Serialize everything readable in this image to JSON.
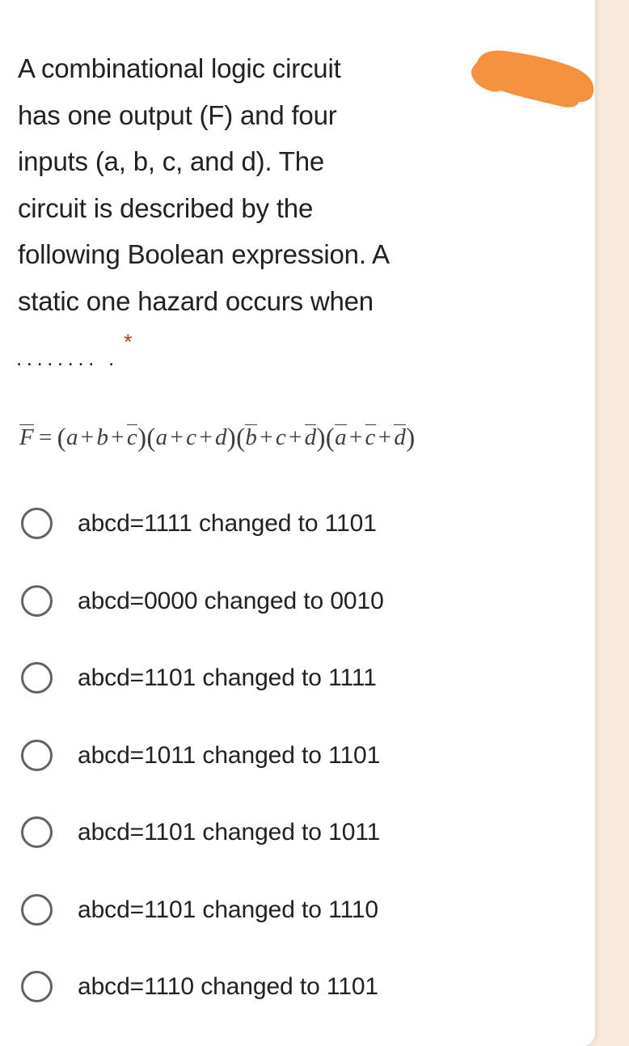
{
  "colors": {
    "page_background": "#faeadb",
    "card_background": "#ffffff",
    "text": "#202124",
    "required_asterisk": "#d93025",
    "highlight_orange": "#f5913e",
    "radio_border": "#5f6368",
    "expression_text": "#3a3f47"
  },
  "question": {
    "lines": [
      "A combinational logic circuit",
      "has one output (F) and four",
      "inputs (a, b, c, and d). The",
      "circuit is described by the",
      "following Boolean expression. A",
      "static one hazard occurs when"
    ],
    "full_text": "A combinational logic circuit has one output (F) and four inputs (a, b, c, and d). The circuit is described by the following Boolean expression. A static one hazard occurs when ......... .",
    "dotted_line": "........",
    "dot_tail": ".",
    "required_marker": "*"
  },
  "expression": {
    "plain": "F̄ = (a + b + c̄)(a + c + d)(b̄ + c + d̄)(ā + c̄ + d̄)",
    "lhs": "F",
    "equals": "=",
    "factors": [
      {
        "terms": [
          {
            "var": "a",
            "bar": false
          },
          {
            "var": "b",
            "bar": false
          },
          {
            "var": "c",
            "bar": true
          }
        ]
      },
      {
        "terms": [
          {
            "var": "a",
            "bar": false
          },
          {
            "var": "c",
            "bar": false
          },
          {
            "var": "d",
            "bar": false
          }
        ]
      },
      {
        "terms": [
          {
            "var": "b",
            "bar": true
          },
          {
            "var": "c",
            "bar": false
          },
          {
            "var": "d",
            "bar": true
          }
        ]
      },
      {
        "terms": [
          {
            "var": "a",
            "bar": true
          },
          {
            "var": "c",
            "bar": true
          },
          {
            "var": "d",
            "bar": true
          }
        ]
      }
    ]
  },
  "options": [
    {
      "label": "abcd=1111 changed to 1101",
      "selected": false
    },
    {
      "label": "abcd=0000 changed to 0010",
      "selected": false
    },
    {
      "label": "abcd=1101 changed to 1111",
      "selected": false
    },
    {
      "label": "abcd=1011 changed to 1101",
      "selected": false
    },
    {
      "label": "abcd=1101 changed to 1011",
      "selected": false
    },
    {
      "label": "abcd=1101 changed to 1110",
      "selected": false
    },
    {
      "label": "abcd=1110 changed to 1101",
      "selected": false
    }
  ],
  "annotation": {
    "highlight_mark": "orange-highlighter-stroke"
  }
}
